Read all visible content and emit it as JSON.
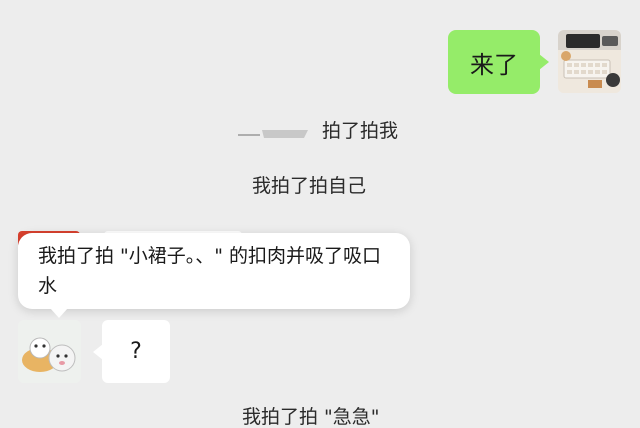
{
  "chat": {
    "outgoing_message": "来了",
    "pat_line_1_suffix": "拍了拍我",
    "pat_line_2": "我拍了拍自己",
    "popup_text": "我拍了拍 \"小裙子。、\" 的扣肉并吸了吸口水",
    "incoming_message": "?",
    "bottom_pat_line": "我拍了拍 \"急急\""
  }
}
